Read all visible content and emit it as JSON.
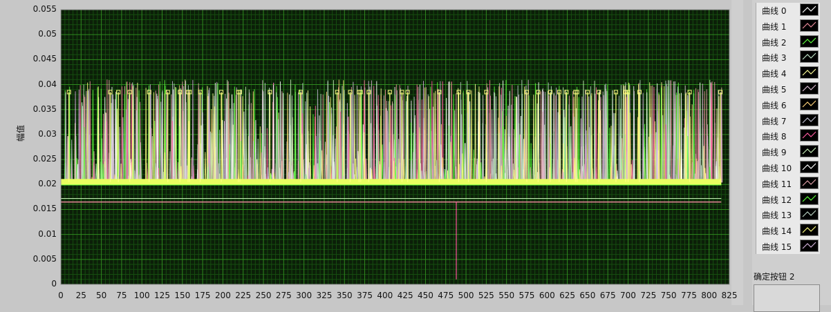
{
  "chart_data": {
    "type": "line",
    "ylabel": "幅值",
    "xlabel": "",
    "xlim": [
      0,
      825
    ],
    "ylim": [
      0,
      0.055
    ],
    "x_ticks": [
      "0",
      "25",
      "50",
      "75",
      "100",
      "125",
      "150",
      "175",
      "200",
      "225",
      "250",
      "275",
      "300",
      "325",
      "350",
      "375",
      "400",
      "425",
      "450",
      "475",
      "500",
      "525",
      "550",
      "575",
      "600",
      "625",
      "650",
      "675",
      "700",
      "725",
      "750",
      "775",
      "800",
      "825"
    ],
    "y_ticks": [
      "0",
      "0.005",
      "0.01",
      "0.015",
      "0.02",
      "0.025",
      "0.03",
      "0.035",
      "0.04",
      "0.045",
      "0.05",
      "0.055"
    ],
    "grid": true,
    "legend_position": "right",
    "baseline": 0.0205,
    "lower_level": 0.0165,
    "spike_peak": 0.041,
    "dip": {
      "x": 488,
      "y": 0.001
    },
    "marker_level": 0.0385,
    "marker_x": [
      10,
      61,
      71,
      85,
      109,
      132,
      147,
      157,
      159,
      172,
      198,
      219,
      221,
      258,
      296,
      341,
      357,
      368,
      370,
      380,
      406,
      421,
      428,
      467,
      491,
      503,
      525,
      575,
      589,
      604,
      615,
      624,
      635,
      637,
      650,
      664,
      685,
      697,
      700,
      714,
      776,
      814
    ],
    "series": [
      {
        "name": "曲线 0",
        "color": "#ffffff"
      },
      {
        "name": "曲线 1",
        "color": "#e98a9a"
      },
      {
        "name": "曲线 2",
        "color": "#5cff3c"
      },
      {
        "name": "曲线 3",
        "color": "#bfe3c8"
      },
      {
        "name": "曲线 4",
        "color": "#ffff9a"
      },
      {
        "name": "曲线 5",
        "color": "#d8b9cf"
      },
      {
        "name": "曲线 6",
        "color": "#ffd27a"
      },
      {
        "name": "曲线 7",
        "color": "#c0c0d0"
      },
      {
        "name": "曲线 8",
        "color": "#ff5aa0"
      },
      {
        "name": "曲线 9",
        "color": "#c8f0b8"
      },
      {
        "name": "曲线 10",
        "color": "#ffffff"
      },
      {
        "name": "曲线 11",
        "color": "#e0a0a8"
      },
      {
        "name": "曲线 12",
        "color": "#5cff3c"
      },
      {
        "name": "曲线 13",
        "color": "#b8d0c0"
      },
      {
        "name": "曲线 14",
        "color": "#ffff80"
      },
      {
        "name": "曲线 15",
        "color": "#d0b0d8"
      }
    ]
  },
  "legend": {
    "items": [
      "曲线 0",
      "曲线 1",
      "曲线 2",
      "曲线 3",
      "曲线 4",
      "曲线 5",
      "曲线 6",
      "曲线 7",
      "曲线 8",
      "曲线 9",
      "曲线 10",
      "曲线 11",
      "曲线 12",
      "曲线 13",
      "曲线 14",
      "曲线 15"
    ]
  },
  "button": {
    "label": "确定按钮 2"
  },
  "colors": {
    "plot_bg": "#0b1f08",
    "grid_major": "#2f8a1f",
    "grid_minor": "#164d10",
    "frame": "#9a9a9a"
  }
}
